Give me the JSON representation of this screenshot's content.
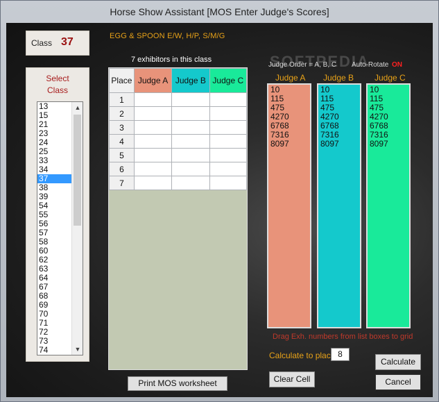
{
  "window": {
    "title": "Horse Show Assistant  [MOS Enter Judge's Scores]"
  },
  "class_box": {
    "label": "Class",
    "value": "37"
  },
  "select_class": {
    "title_line1": "Select",
    "title_line2": "Class",
    "items": [
      "13",
      "15",
      "21",
      "23",
      "24",
      "25",
      "33",
      "34",
      "37",
      "38",
      "39",
      "54",
      "55",
      "56",
      "57",
      "58",
      "60",
      "62",
      "63",
      "64",
      "67",
      "68",
      "69",
      "70",
      "71",
      "72",
      "73",
      "74"
    ],
    "selected": "37"
  },
  "class_title": "EGG & SPOON E/W, H/P, S/M/G",
  "exhibitor_count": "7 exhibitors in this class",
  "grid": {
    "headers": [
      "Place",
      "Judge A",
      "Judge B",
      "Judge C"
    ],
    "rows": [
      "1",
      "2",
      "3",
      "4",
      "5",
      "6",
      "7"
    ]
  },
  "buttons": {
    "print": "Print MOS worksheet",
    "clear_cell": "Clear Cell",
    "calculate": "Calculate",
    "cancel": "Cancel"
  },
  "watermark": "SOFTPEDIA",
  "judge_order": "Judge Order = A, B, C",
  "auto_rotate": {
    "label": "Auto-Rotate",
    "state": "ON"
  },
  "judges": [
    {
      "name": "Judge A",
      "numbers": [
        "10",
        "115",
        "475",
        "4270",
        "6768",
        "7316",
        "8097"
      ]
    },
    {
      "name": "Judge B",
      "numbers": [
        "10",
        "115",
        "475",
        "4270",
        "6768",
        "7316",
        "8097"
      ]
    },
    {
      "name": "Judge C",
      "numbers": [
        "10",
        "115",
        "475",
        "4270",
        "6768",
        "7316",
        "8097"
      ]
    }
  ],
  "drag_hint": "Drag Exh. numbers from list boxes to grid",
  "calculate_to": {
    "label": "Calculate to place",
    "value": "8"
  },
  "colors": {
    "judge_a": "#e8937a",
    "judge_b": "#14c9cc",
    "judge_c": "#19ea9a",
    "accent_orange": "#e8a218",
    "alert_red": "#ff2020"
  }
}
